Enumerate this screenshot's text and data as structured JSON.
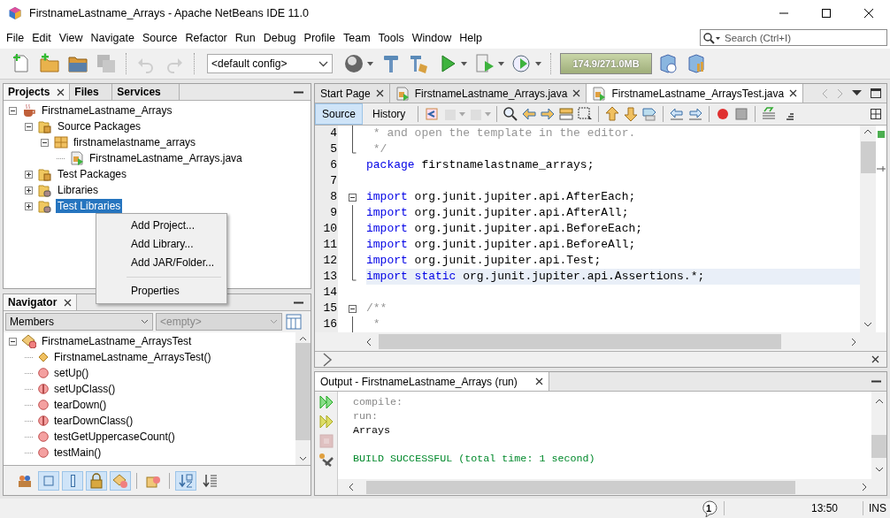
{
  "window": {
    "title": "FirstnameLastname_Arrays - Apache NetBeans IDE 11.0"
  },
  "menu": [
    "File",
    "Edit",
    "View",
    "Navigate",
    "Source",
    "Refactor",
    "Run",
    "Debug",
    "Profile",
    "Team",
    "Tools",
    "Window",
    "Help"
  ],
  "search": {
    "placeholder": "Search (Ctrl+I)"
  },
  "toolbar": [
    {
      "kind": "new-file",
      "disabled": false
    },
    {
      "kind": "new-project",
      "disabled": false
    },
    {
      "kind": "open-project",
      "disabled": false
    },
    {
      "kind": "save-all",
      "disabled": true
    },
    {
      "kind": "separator"
    },
    {
      "kind": "undo",
      "disabled": true
    },
    {
      "kind": "redo",
      "disabled": true
    },
    {
      "kind": "separator"
    },
    {
      "kind": "config",
      "value": "<default config>"
    },
    {
      "kind": "globe",
      "disabled": false,
      "has_menu": true
    },
    {
      "kind": "build",
      "disabled": false
    },
    {
      "kind": "clean-build",
      "disabled": false
    },
    {
      "kind": "run",
      "disabled": false,
      "has_menu": true
    },
    {
      "kind": "debug",
      "disabled": false,
      "has_menu": true
    },
    {
      "kind": "profile",
      "disabled": false,
      "has_menu": true
    },
    {
      "kind": "separator"
    },
    {
      "kind": "memory",
      "text": "174.9/271.0MB"
    },
    {
      "kind": "gc",
      "disabled": false
    },
    {
      "kind": "profile-ide",
      "disabled": false
    }
  ],
  "projects_panel": {
    "tabs": [
      {
        "label": "Projects",
        "selected": true,
        "closable": true
      },
      {
        "label": "Files",
        "selected": false,
        "closable": false
      },
      {
        "label": "Services",
        "selected": false,
        "closable": false
      }
    ],
    "tree": [
      {
        "label": "FirstnameLastname_Arrays",
        "kind": "project",
        "expanded": true,
        "selected": false,
        "children": [
          {
            "label": "Source Packages",
            "kind": "source-folder",
            "expanded": true,
            "selected": false,
            "children": [
              {
                "label": "firstnamelastname_arrays",
                "kind": "package",
                "expanded": true,
                "selected": false,
                "children": [
                  {
                    "label": "FirstnameLastname_Arrays.java",
                    "kind": "java-file",
                    "selected": false
                  }
                ]
              }
            ]
          },
          {
            "label": "Test Packages",
            "kind": "source-folder",
            "expanded": false,
            "selected": false
          },
          {
            "label": "Libraries",
            "kind": "library-folder",
            "expanded": false,
            "selected": false
          },
          {
            "label": "Test Libraries",
            "kind": "library-folder",
            "expanded": false,
            "selected": true
          }
        ]
      }
    ]
  },
  "context_menu": [
    {
      "kind": "item",
      "label": "Add Project..."
    },
    {
      "kind": "item",
      "label": "Add Library..."
    },
    {
      "kind": "item",
      "label": "Add JAR/Folder..."
    },
    {
      "kind": "separator"
    },
    {
      "kind": "item",
      "label": "Properties"
    }
  ],
  "navigator": {
    "title": "Navigator",
    "filter": {
      "value": "Members"
    },
    "scope": {
      "placeholder": "<empty>",
      "disabled": true
    },
    "tree": [
      {
        "label": "FirstnameLastname_ArraysTest",
        "kind": "class",
        "expanded": true,
        "children": [
          {
            "label": "FirstnameLastname_ArraysTest()",
            "kind": "constructor"
          },
          {
            "label": "setUp()",
            "kind": "method"
          },
          {
            "label": "setUpClass()",
            "kind": "static-method"
          },
          {
            "label": "tearDown()",
            "kind": "method"
          },
          {
            "label": "tearDownClass()",
            "kind": "static-method"
          },
          {
            "label": "testGetUppercaseCount()",
            "kind": "method"
          },
          {
            "label": "testMain()",
            "kind": "method"
          }
        ]
      }
    ],
    "filters": [
      {
        "kind": "inherited",
        "on": false
      },
      {
        "kind": "fields",
        "on": true
      },
      {
        "kind": "static",
        "on": true
      },
      {
        "kind": "non-public",
        "on": true
      },
      {
        "kind": "local-classes",
        "on": true
      },
      {
        "kind": "separator"
      },
      {
        "kind": "fqn",
        "on": false
      },
      {
        "kind": "separator"
      },
      {
        "kind": "sort-name",
        "on": true
      },
      {
        "kind": "sort-source",
        "on": false
      }
    ]
  },
  "editor": {
    "tabs": [
      {
        "label": "Start Page",
        "selected": false,
        "kind": "page"
      },
      {
        "label": "FirstnameLastname_Arrays.java",
        "selected": false,
        "kind": "java"
      },
      {
        "label": "FirstnameLastname_ArraysTest.java",
        "selected": true,
        "kind": "java-test"
      }
    ],
    "views": [
      {
        "label": "Source",
        "selected": true
      },
      {
        "label": "History",
        "selected": false
      }
    ],
    "tools": [
      {
        "kind": "last-edit",
        "disabled": false
      },
      {
        "kind": "back",
        "disabled": true
      },
      {
        "kind": "forward",
        "disabled": true
      },
      {
        "kind": "separator"
      },
      {
        "kind": "find",
        "disabled": false
      },
      {
        "kind": "find-prev",
        "disabled": false
      },
      {
        "kind": "find-next",
        "disabled": false
      },
      {
        "kind": "highlight",
        "disabled": false
      },
      {
        "kind": "rect-select",
        "disabled": false
      },
      {
        "kind": "separator"
      },
      {
        "kind": "prev-bookmark",
        "disabled": false
      },
      {
        "kind": "next-bookmark",
        "disabled": false
      },
      {
        "kind": "toggle-bookmark",
        "disabled": false
      },
      {
        "kind": "separator"
      },
      {
        "kind": "shift-left",
        "disabled": false
      },
      {
        "kind": "shift-right",
        "disabled": false
      },
      {
        "kind": "separator"
      },
      {
        "kind": "record",
        "disabled": false
      },
      {
        "kind": "stop",
        "disabled": false
      },
      {
        "kind": "separator"
      },
      {
        "kind": "comment",
        "disabled": false
      },
      {
        "kind": "uncomment",
        "disabled": false
      }
    ],
    "lines": [
      {
        "number": "4",
        "fold_start": false,
        "fold_end": false,
        "highlighted": false,
        "segments": [
          {
            "kind": "comment",
            "text": " * and open the template in the editor."
          }
        ]
      },
      {
        "number": "5",
        "fold_start": false,
        "fold_end": true,
        "highlighted": false,
        "segments": [
          {
            "kind": "comment",
            "text": " */"
          }
        ]
      },
      {
        "number": "6",
        "fold_start": false,
        "fold_end": false,
        "highlighted": false,
        "segments": [
          {
            "kind": "keyword",
            "text": "package"
          },
          {
            "kind": "plain",
            "text": " firstnamelastname_arrays;"
          }
        ]
      },
      {
        "number": "7",
        "fold_start": false,
        "fold_end": false,
        "highlighted": false
      },
      {
        "number": "8",
        "fold_start": true,
        "fold_end": false,
        "highlighted": false,
        "segments": [
          {
            "kind": "keyword",
            "text": "import"
          },
          {
            "kind": "plain",
            "text": " org.junit.jupiter.api.AfterEach;"
          }
        ]
      },
      {
        "number": "9",
        "fold_start": false,
        "fold_end": false,
        "highlighted": false,
        "segments": [
          {
            "kind": "keyword",
            "text": "import"
          },
          {
            "kind": "plain",
            "text": " org.junit.jupiter.api.AfterAll;"
          }
        ]
      },
      {
        "number": "10",
        "fold_start": false,
        "fold_end": false,
        "highlighted": false,
        "segments": [
          {
            "kind": "keyword",
            "text": "import"
          },
          {
            "kind": "plain",
            "text": " org.junit.jupiter.api.BeforeEach;"
          }
        ]
      },
      {
        "number": "11",
        "fold_start": false,
        "fold_end": false,
        "highlighted": false,
        "segments": [
          {
            "kind": "keyword",
            "text": "import"
          },
          {
            "kind": "plain",
            "text": " org.junit.jupiter.api.BeforeAll;"
          }
        ]
      },
      {
        "number": "12",
        "fold_start": false,
        "fold_end": false,
        "highlighted": false,
        "segments": [
          {
            "kind": "keyword",
            "text": "import"
          },
          {
            "kind": "plain",
            "text": " org.junit.jupiter.api.Test;"
          }
        ]
      },
      {
        "number": "13",
        "fold_start": false,
        "fold_end": true,
        "highlighted": true,
        "segments": [
          {
            "kind": "keyword",
            "text": "import"
          },
          {
            "kind": "keyword",
            "text": " static"
          },
          {
            "kind": "plain",
            "text": " org.junit.jupiter.api.Assertions.*;"
          }
        ]
      },
      {
        "number": "14",
        "fold_start": false,
        "fold_end": false,
        "highlighted": false
      },
      {
        "number": "15",
        "fold_start": true,
        "fold_end": false,
        "highlighted": false,
        "segments": [
          {
            "kind": "comment",
            "text": "/**"
          }
        ]
      },
      {
        "number": "16",
        "fold_start": false,
        "fold_end": false,
        "highlighted": false,
        "segments": [
          {
            "kind": "comment",
            "text": " *"
          }
        ]
      }
    ]
  },
  "output": {
    "title": "Output - FirstnameLastname_Arrays (run)",
    "actions": [
      {
        "kind": "rerun",
        "disabled": false
      },
      {
        "kind": "rerun-params",
        "disabled": false
      },
      {
        "kind": "stop",
        "disabled": true
      },
      {
        "kind": "settings",
        "disabled": false
      }
    ],
    "lines": [
      {
        "kind": "muted",
        "text": "compile:"
      },
      {
        "kind": "muted",
        "text": "run:"
      },
      {
        "kind": "plain",
        "text": "Arrays"
      },
      {
        "kind": "blank"
      },
      {
        "kind": "success",
        "text": "BUILD SUCCESSFUL (total time: 1 second)"
      }
    ]
  },
  "status_bar": {
    "notifications": "1",
    "time": "13:50",
    "mode": "INS"
  }
}
